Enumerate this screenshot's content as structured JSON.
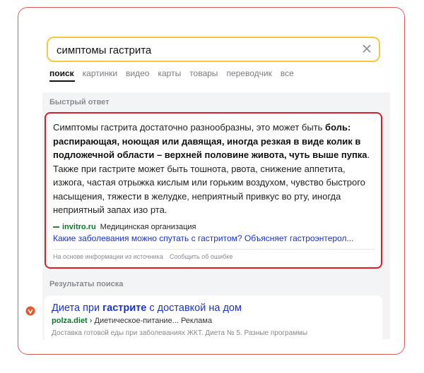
{
  "search": {
    "query": "симптомы гастрита"
  },
  "tabs": [
    "поиск",
    "картинки",
    "видео",
    "карты",
    "товары",
    "переводчик",
    "все"
  ],
  "answer": {
    "section_title": "Быстрый ответ",
    "text_intro": "Симптомы гастрита достаточно разнообразны, это может быть ",
    "text_bold": "боль: распирающая, ноющая или давящая, иногда резкая в виде колик в подложечной области – верхней половине живота, чуть выше пупка",
    "text_rest": ". Также при гастрите может быть тошнота, рвота, снижение аппетита, изжога, частая отрыжка кислым или горьким воздухом, чувство быстрого насыщения, тяжести в желудке, неприятный привкус во рту, иногда неприятный запах изо рта.",
    "source_domain": "invitro.ru",
    "source_type": "Медицинская организация",
    "source_link": "Какие заболевания можно спутать с гастритом? Объясняет гастроэнтерол...",
    "footer_source": "На основе информации из источника",
    "footer_report": "Сообщить об ошибке"
  },
  "results": {
    "section_title": "Результаты поиска",
    "items": [
      {
        "title_before": "Диета при ",
        "title_bold": "гастрите",
        "title_after": " с доставкой на дом",
        "domain": "polza.diet",
        "path": "› Диетическое-питание...",
        "ad_label": "Реклама",
        "snippet": "Доставка готовой еды при заболеваниях ЖКТ. Диета № 5. Разные программы"
      }
    ]
  },
  "colors": {
    "highlight_border": "#d91f26",
    "search_border": "#f5c842",
    "link": "#1a33c9",
    "domain": "#0a7a2a"
  }
}
